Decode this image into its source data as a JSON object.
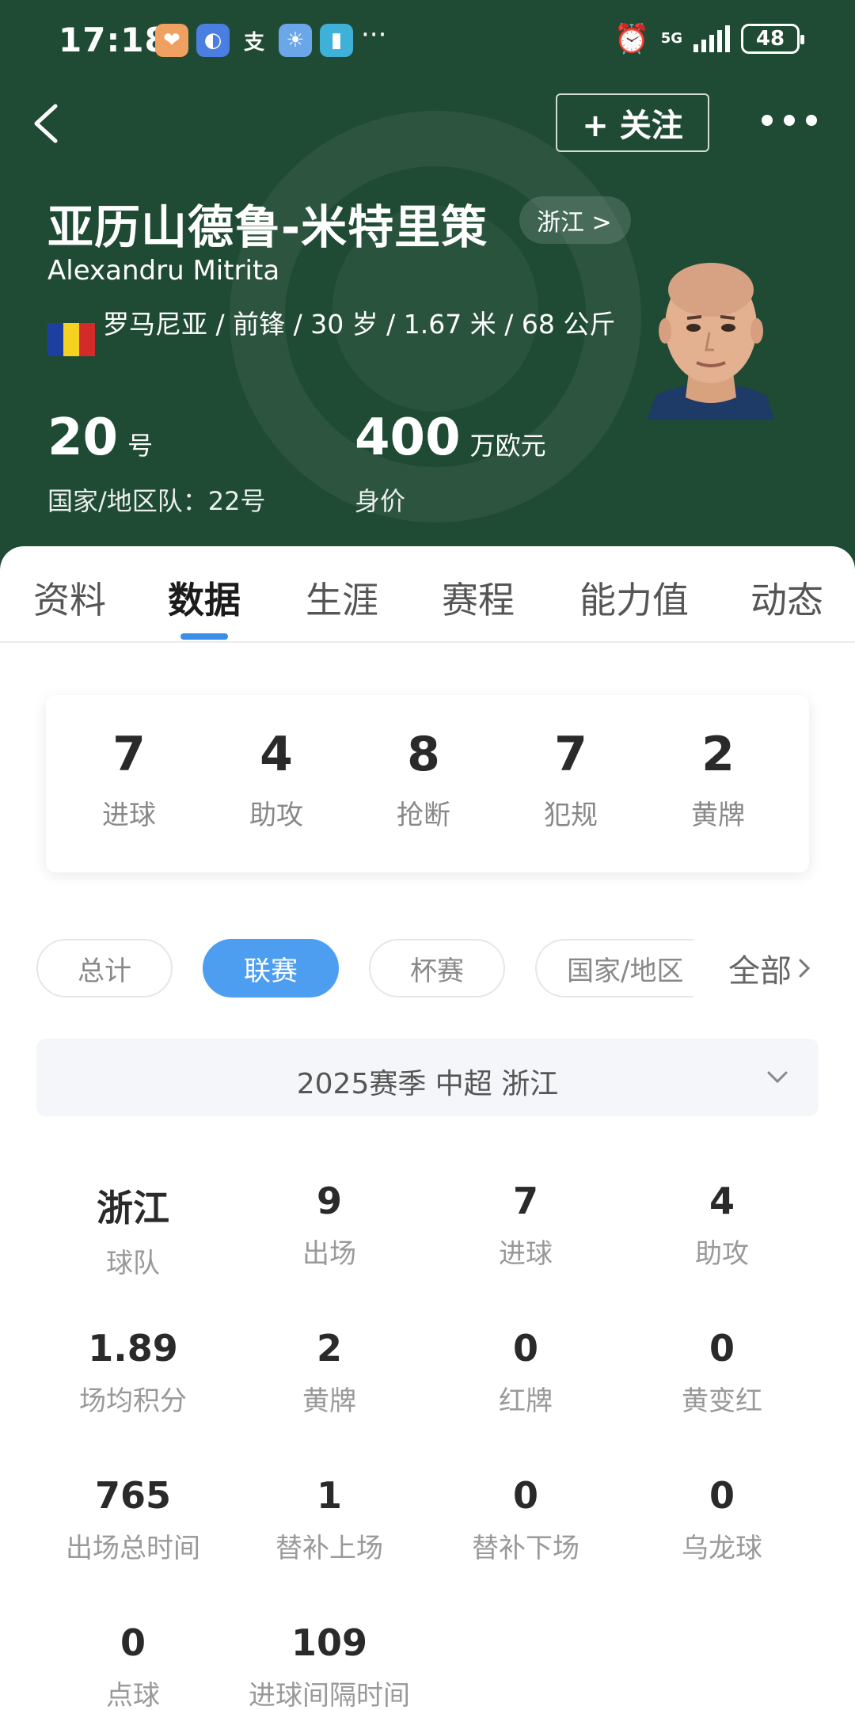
{
  "status_bar": {
    "time": "17:18",
    "network": "5G",
    "battery": "48",
    "app_icons": [
      {
        "name": "heart-app-icon",
        "glyph": "❤",
        "color": "#f0a060"
      },
      {
        "name": "browser-app-icon",
        "glyph": "◐",
        "color": "#4a7ee0"
      },
      {
        "name": "alipay-app-icon",
        "glyph": "支",
        "color": "transparent"
      },
      {
        "name": "weather-app-icon",
        "glyph": "☀",
        "color": "#6aa6e8"
      },
      {
        "name": "book-app-icon",
        "glyph": "▮",
        "color": "#3fb0d8"
      }
    ]
  },
  "header": {
    "follow_label": "+ 关注",
    "name_cn": "亚历山德鲁-米特里策",
    "team_link": "浙江 >",
    "name_en": "Alexandru Mitrita",
    "info_line": "罗马尼亚 / 前锋 / 30 岁 / 1.67 米 / 68 公斤",
    "flag_colors": [
      "#1d3fa0",
      "#f4d21f",
      "#d32a2a"
    ],
    "shirt_number": "20",
    "shirt_unit": "号",
    "national_number": "国家/地区队：22号",
    "market_value": "400",
    "market_value_unit": "万欧元",
    "market_value_label": "身价",
    "theme_color": "#1f4a34"
  },
  "tabs": [
    {
      "label": "资料"
    },
    {
      "label": "数据"
    },
    {
      "label": "生涯"
    },
    {
      "label": "赛程"
    },
    {
      "label": "能力值"
    },
    {
      "label": "动态"
    }
  ],
  "summary": [
    {
      "value": "7",
      "label": "进球"
    },
    {
      "value": "4",
      "label": "助攻"
    },
    {
      "value": "8",
      "label": "抢断"
    },
    {
      "value": "7",
      "label": "犯规"
    },
    {
      "value": "2",
      "label": "黄牌"
    }
  ],
  "filters": [
    {
      "label": "总计"
    },
    {
      "label": "联赛"
    },
    {
      "label": "杯赛"
    },
    {
      "label": "国家/地区"
    }
  ],
  "filter_all_label": "全部",
  "season_selector": "2025赛季 中超 浙江",
  "stats": [
    {
      "value": "浙江",
      "label": "球队"
    },
    {
      "value": "9",
      "label": "出场"
    },
    {
      "value": "7",
      "label": "进球"
    },
    {
      "value": "4",
      "label": "助攻"
    },
    {
      "value": "1.89",
      "label": "场均积分"
    },
    {
      "value": "2",
      "label": "黄牌"
    },
    {
      "value": "0",
      "label": "红牌"
    },
    {
      "value": "0",
      "label": "黄变红"
    },
    {
      "value": "765",
      "label": "出场总时间"
    },
    {
      "value": "1",
      "label": "替补上场"
    },
    {
      "value": "0",
      "label": "替补下场"
    },
    {
      "value": "0",
      "label": "乌龙球"
    },
    {
      "value": "0",
      "label": "点球"
    },
    {
      "value": "109",
      "label": "进球间隔时间"
    }
  ],
  "accent_color": "#4d9ef0"
}
